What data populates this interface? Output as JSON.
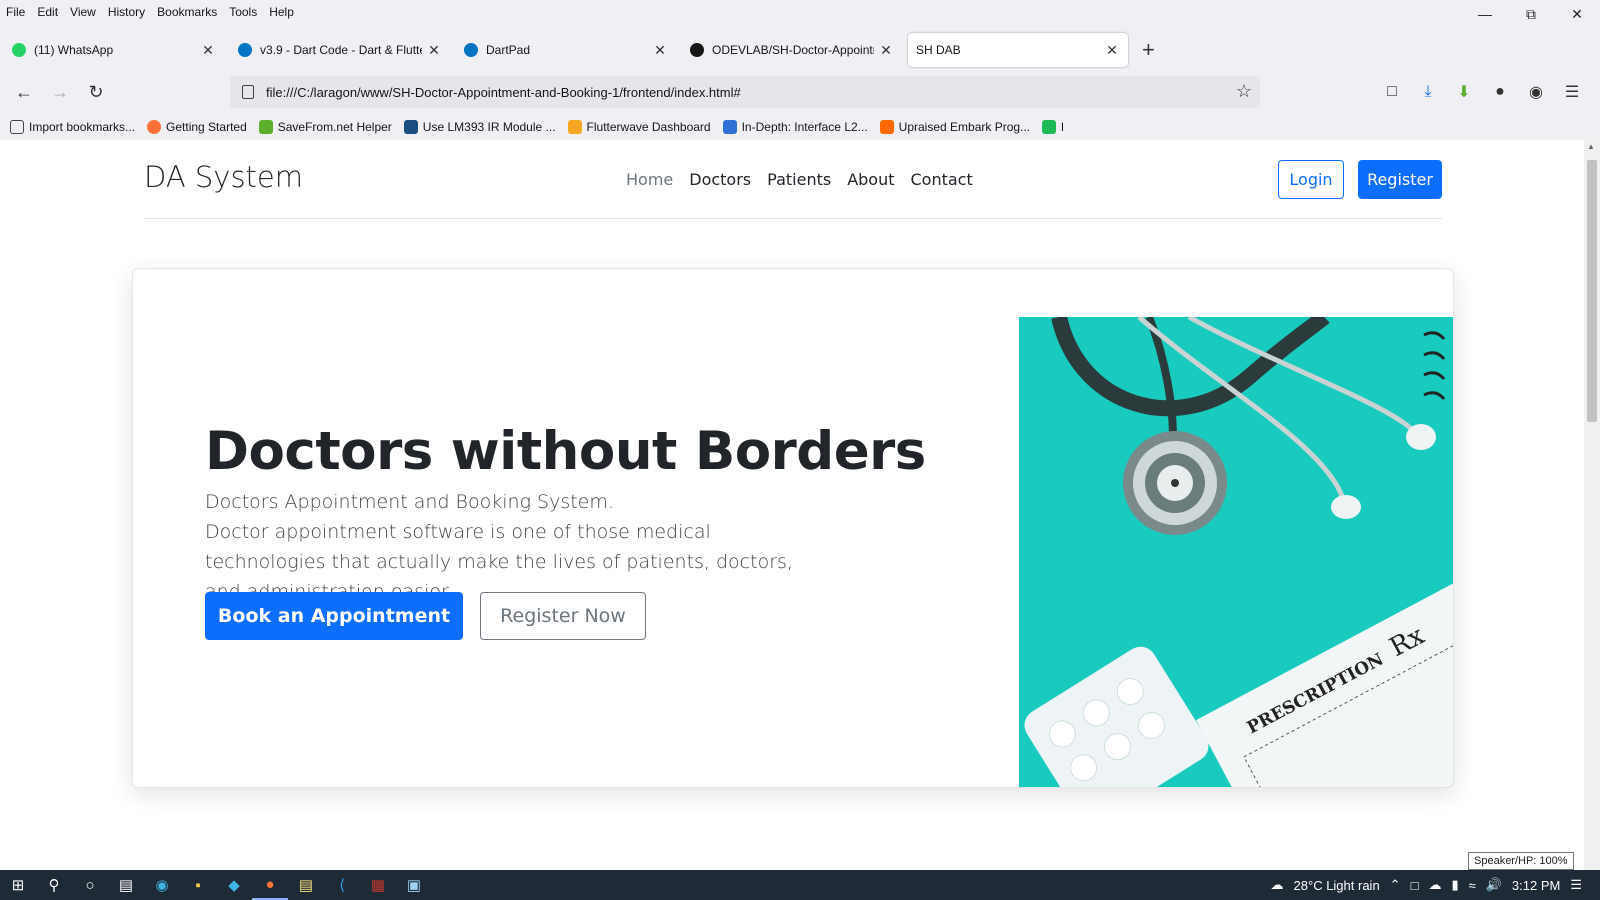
{
  "menu": [
    "File",
    "Edit",
    "View",
    "History",
    "Bookmarks",
    "Tools",
    "Help"
  ],
  "tabs": [
    {
      "label": "(11) WhatsApp",
      "icon": "whatsapp-icon",
      "color": "#25d366"
    },
    {
      "label": "v3.9 - Dart Code - Dart & Flutter",
      "icon": "dart-code-icon",
      "color": "#0175c2"
    },
    {
      "label": "DartPad",
      "icon": "dartpad-icon",
      "color": "#0175c2"
    },
    {
      "label": "ODEVLAB/SH-Doctor-Appointment",
      "icon": "github-icon",
      "color": "#181717"
    },
    {
      "label": "SH DAB",
      "icon": "page-icon",
      "color": "#ffffff"
    }
  ],
  "url": "file:///C:/laragon/www/SH-Doctor-Appointment-and-Booking-1/frontend/index.html#",
  "bookmarks": [
    {
      "label": "Import bookmarks...",
      "icon": "import-icon"
    },
    {
      "label": "Getting Started",
      "icon": "firefox-icon"
    },
    {
      "label": "SaveFrom.net Helper",
      "icon": "download-arrow-icon"
    },
    {
      "label": "Use LM393 IR Module ...",
      "icon": "site-icon"
    },
    {
      "label": "Flutterwave Dashboard",
      "icon": "flutterwave-icon"
    },
    {
      "label": "In-Depth: Interface L2...",
      "icon": "site-icon"
    },
    {
      "label": "Upraised Embark Prog...",
      "icon": "upraised-icon"
    },
    {
      "label": "l",
      "icon": "pd-icon"
    }
  ],
  "site": {
    "brand": "DA System",
    "nav": [
      "Home",
      "Doctors",
      "Patients",
      "About",
      "Contact"
    ],
    "login": "Login",
    "register": "Register"
  },
  "hero": {
    "title": "Doctors without Borders",
    "subtitle": "Doctors Appointment and Booking System.",
    "description": "Doctor appointment software is one of those medical technologies that actually make the lives of patients, doctors, and administration easier.",
    "book_button": "Book an Appointment",
    "register_button": "Register Now",
    "image_text_prescription": "PRESCRIPTION",
    "image_text_rx": "Rx"
  },
  "speaker": "Speaker/HP: 100%",
  "taskbar": {
    "weather": "28°C  Light rain",
    "time": "3:12 PM"
  },
  "colors": {
    "primary": "#0d6efd",
    "teal": "#1ccfc2"
  }
}
